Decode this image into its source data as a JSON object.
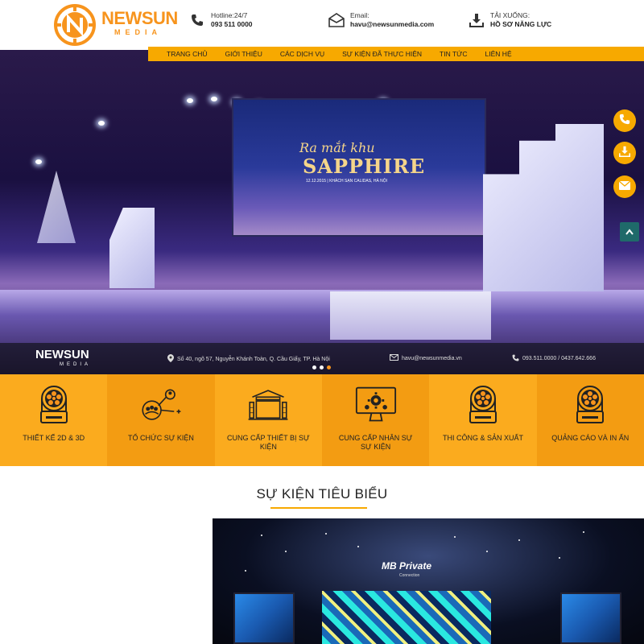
{
  "header": {
    "logo_text": "NEWSUN",
    "logo_sub": "MEDIA",
    "hotline_label": "Hotline:24/7",
    "hotline_value": "093 511 0000",
    "email_label": "Email:",
    "email_value": "havu@newsunmedia.com",
    "download_label": "TẢI XUỐNG:",
    "download_value": "HỒ SƠ NĂNG LỰC"
  },
  "nav": {
    "items": [
      "TRANG CHỦ",
      "GIỚI THIỆU",
      "CÁC DỊCH VỤ",
      "SỰ KIỆN ĐÃ THỰC HIỆN",
      "TIN TỨC",
      "LIÊN HỆ"
    ]
  },
  "hero": {
    "screen_line1": "Ra mắt khu",
    "screen_line2": "SAPPHIRE",
    "screen_line3": "12.12.2015 | KHÁCH SẠN CALIDAS, HÀ NỘI",
    "bar_logo": "NEWSUN",
    "bar_logo_sub": "MEDIA",
    "bar_address": "Số 40, ngõ 57, Nguyễn Khánh Toàn, Q. Cầu Giấy, TP. Hà Nội",
    "bar_email": "havu@newsunmedia.vn",
    "bar_phone": "093.511.0000 / 0437.642.666",
    "slide_count": 3,
    "active_slide": 3
  },
  "services": [
    {
      "label": "THIẾT KẾ 2D & 3D",
      "icon": "moving-head-light-icon"
    },
    {
      "label": "TỔ CHỨC SỰ KIỆN",
      "icon": "team-network-icon"
    },
    {
      "label": "CUNG CẤP THIẾT BỊ SỰ KIỆN",
      "icon": "stage-truss-icon"
    },
    {
      "label": "CUNG CẤP NHÂN SỰ SỰ KIỆN",
      "icon": "monitor-gear-icon"
    },
    {
      "label": "THI CÔNG & SẢN XUẤT",
      "icon": "moving-head-light-icon"
    },
    {
      "label": "QUẢNG CÁO VÀ IN ẤN",
      "icon": "moving-head-light-icon"
    }
  ],
  "featured": {
    "title": "SỰ KIỆN TIÊU BIỂU",
    "event_title": "MB Private",
    "event_sub": "Connection"
  },
  "colors": {
    "accent": "#f7a900",
    "orange": "#f7941d",
    "service_light": "#fbab1e",
    "service_dark": "#f39c12",
    "scroll_top": "#1f6a6a"
  }
}
